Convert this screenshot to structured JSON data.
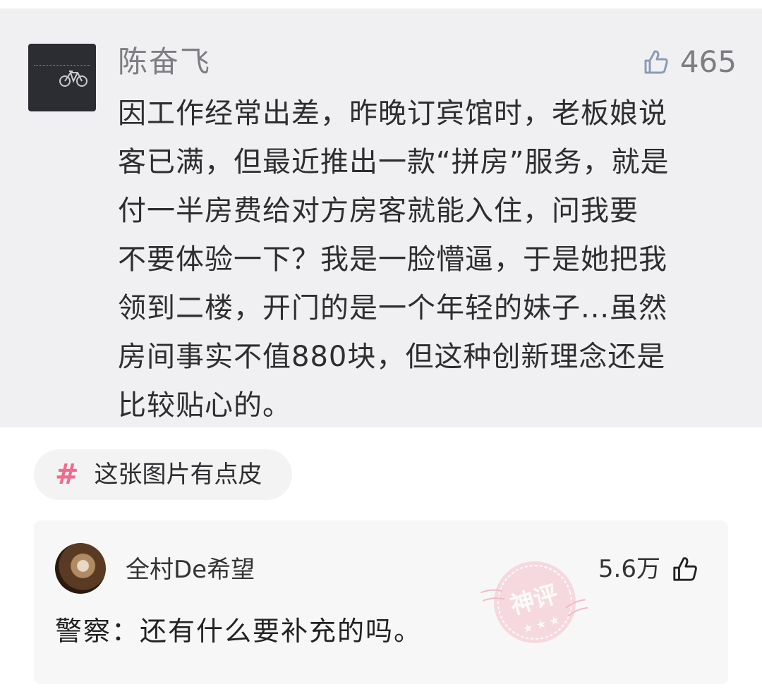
{
  "post": {
    "author": "陈奋飞",
    "likes": "465",
    "body": "因工作经常出差，昨晚订宾馆时，老板娘说客已满，但最近推出一款“拼房”服务，就是付一半房费给对方房客就能入住，问我要不要体验一下？我是一脸懵逼，于是她把我领到二楼，开门的是一个年轻的妹子...虽然房间事实不值880块，但这种创新理念还是比较贴心的。",
    "body_lines": [
      "因工作经常出差，昨晚订宾馆时，老板娘说",
      "客已满，但最近推出一款“拼房”服务，就是",
      "付一半房费给对方房客就能入住，问我要",
      "不要体验一下？我是一脸懵逼，于是她把我",
      "领到二楼，开门的是一个年轻的妹子...虽然",
      "房间事实不值880块，但这种创新理念还是",
      "比较贴心的。"
    ],
    "like_icon": "thumbs-up-icon"
  },
  "topic": {
    "symbol": "#",
    "label": "这张图片有点皮",
    "accent": "#f36a8d"
  },
  "comment": {
    "author": "全村De希望",
    "likes": "5.6万",
    "text": "警察：还有什么要补充的吗。",
    "badge_text": "神评",
    "badge_color": "#f08aa0",
    "like_icon": "thumbs-up-icon"
  }
}
